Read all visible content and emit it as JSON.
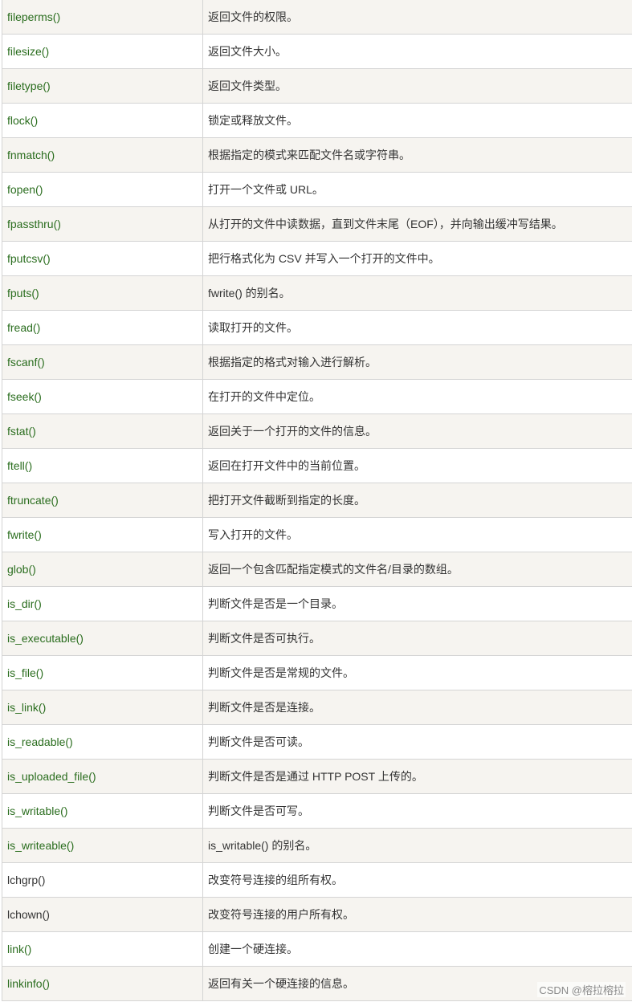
{
  "colors": {
    "link": "#2a6d1e",
    "text": "#333333",
    "row_alt": "#f6f4f0",
    "border": "#d4d4d4"
  },
  "rows": [
    {
      "func": "fileperms()",
      "desc": "返回文件的权限。",
      "link": true
    },
    {
      "func": "filesize()",
      "desc": "返回文件大小。",
      "link": true
    },
    {
      "func": "filetype()",
      "desc": "返回文件类型。",
      "link": true
    },
    {
      "func": "flock()",
      "desc": "锁定或释放文件。",
      "link": true
    },
    {
      "func": "fnmatch()",
      "desc": "根据指定的模式来匹配文件名或字符串。",
      "link": true
    },
    {
      "func": "fopen()",
      "desc": "打开一个文件或 URL。",
      "link": true
    },
    {
      "func": "fpassthru()",
      "desc": "从打开的文件中读数据，直到文件末尾（EOF），并向输出缓冲写结果。",
      "link": true
    },
    {
      "func": "fputcsv()",
      "desc": "把行格式化为 CSV 并写入一个打开的文件中。",
      "link": true
    },
    {
      "func": "fputs()",
      "desc": "fwrite() 的别名。",
      "link": true
    },
    {
      "func": "fread()",
      "desc": "读取打开的文件。",
      "link": true
    },
    {
      "func": "fscanf()",
      "desc": "根据指定的格式对输入进行解析。",
      "link": true
    },
    {
      "func": "fseek()",
      "desc": "在打开的文件中定位。",
      "link": true
    },
    {
      "func": "fstat()",
      "desc": "返回关于一个打开的文件的信息。",
      "link": true
    },
    {
      "func": "ftell()",
      "desc": "返回在打开文件中的当前位置。",
      "link": true
    },
    {
      "func": "ftruncate()",
      "desc": "把打开文件截断到指定的长度。",
      "link": true
    },
    {
      "func": "fwrite()",
      "desc": "写入打开的文件。",
      "link": true
    },
    {
      "func": "glob()",
      "desc": "返回一个包含匹配指定模式的文件名/目录的数组。",
      "link": true
    },
    {
      "func": "is_dir()",
      "desc": "判断文件是否是一个目录。",
      "link": true
    },
    {
      "func": "is_executable()",
      "desc": "判断文件是否可执行。",
      "link": true
    },
    {
      "func": "is_file()",
      "desc": "判断文件是否是常规的文件。",
      "link": true
    },
    {
      "func": "is_link()",
      "desc": "判断文件是否是连接。",
      "link": true
    },
    {
      "func": "is_readable()",
      "desc": "判断文件是否可读。",
      "link": true
    },
    {
      "func": "is_uploaded_file()",
      "desc": "判断文件是否是通过 HTTP POST 上传的。",
      "link": true
    },
    {
      "func": "is_writable()",
      "desc": "判断文件是否可写。",
      "link": true
    },
    {
      "func": "is_writeable()",
      "desc": "is_writable() 的别名。",
      "link": true
    },
    {
      "func": "lchgrp()",
      "desc": "改变符号连接的组所有权。",
      "link": false
    },
    {
      "func": "lchown()",
      "desc": "改变符号连接的用户所有权。",
      "link": false
    },
    {
      "func": "link()",
      "desc": "创建一个硬连接。",
      "link": true
    },
    {
      "func": "linkinfo()",
      "desc": "返回有关一个硬连接的信息。",
      "link": true
    }
  ],
  "watermark": "CSDN @榕拉榕拉"
}
